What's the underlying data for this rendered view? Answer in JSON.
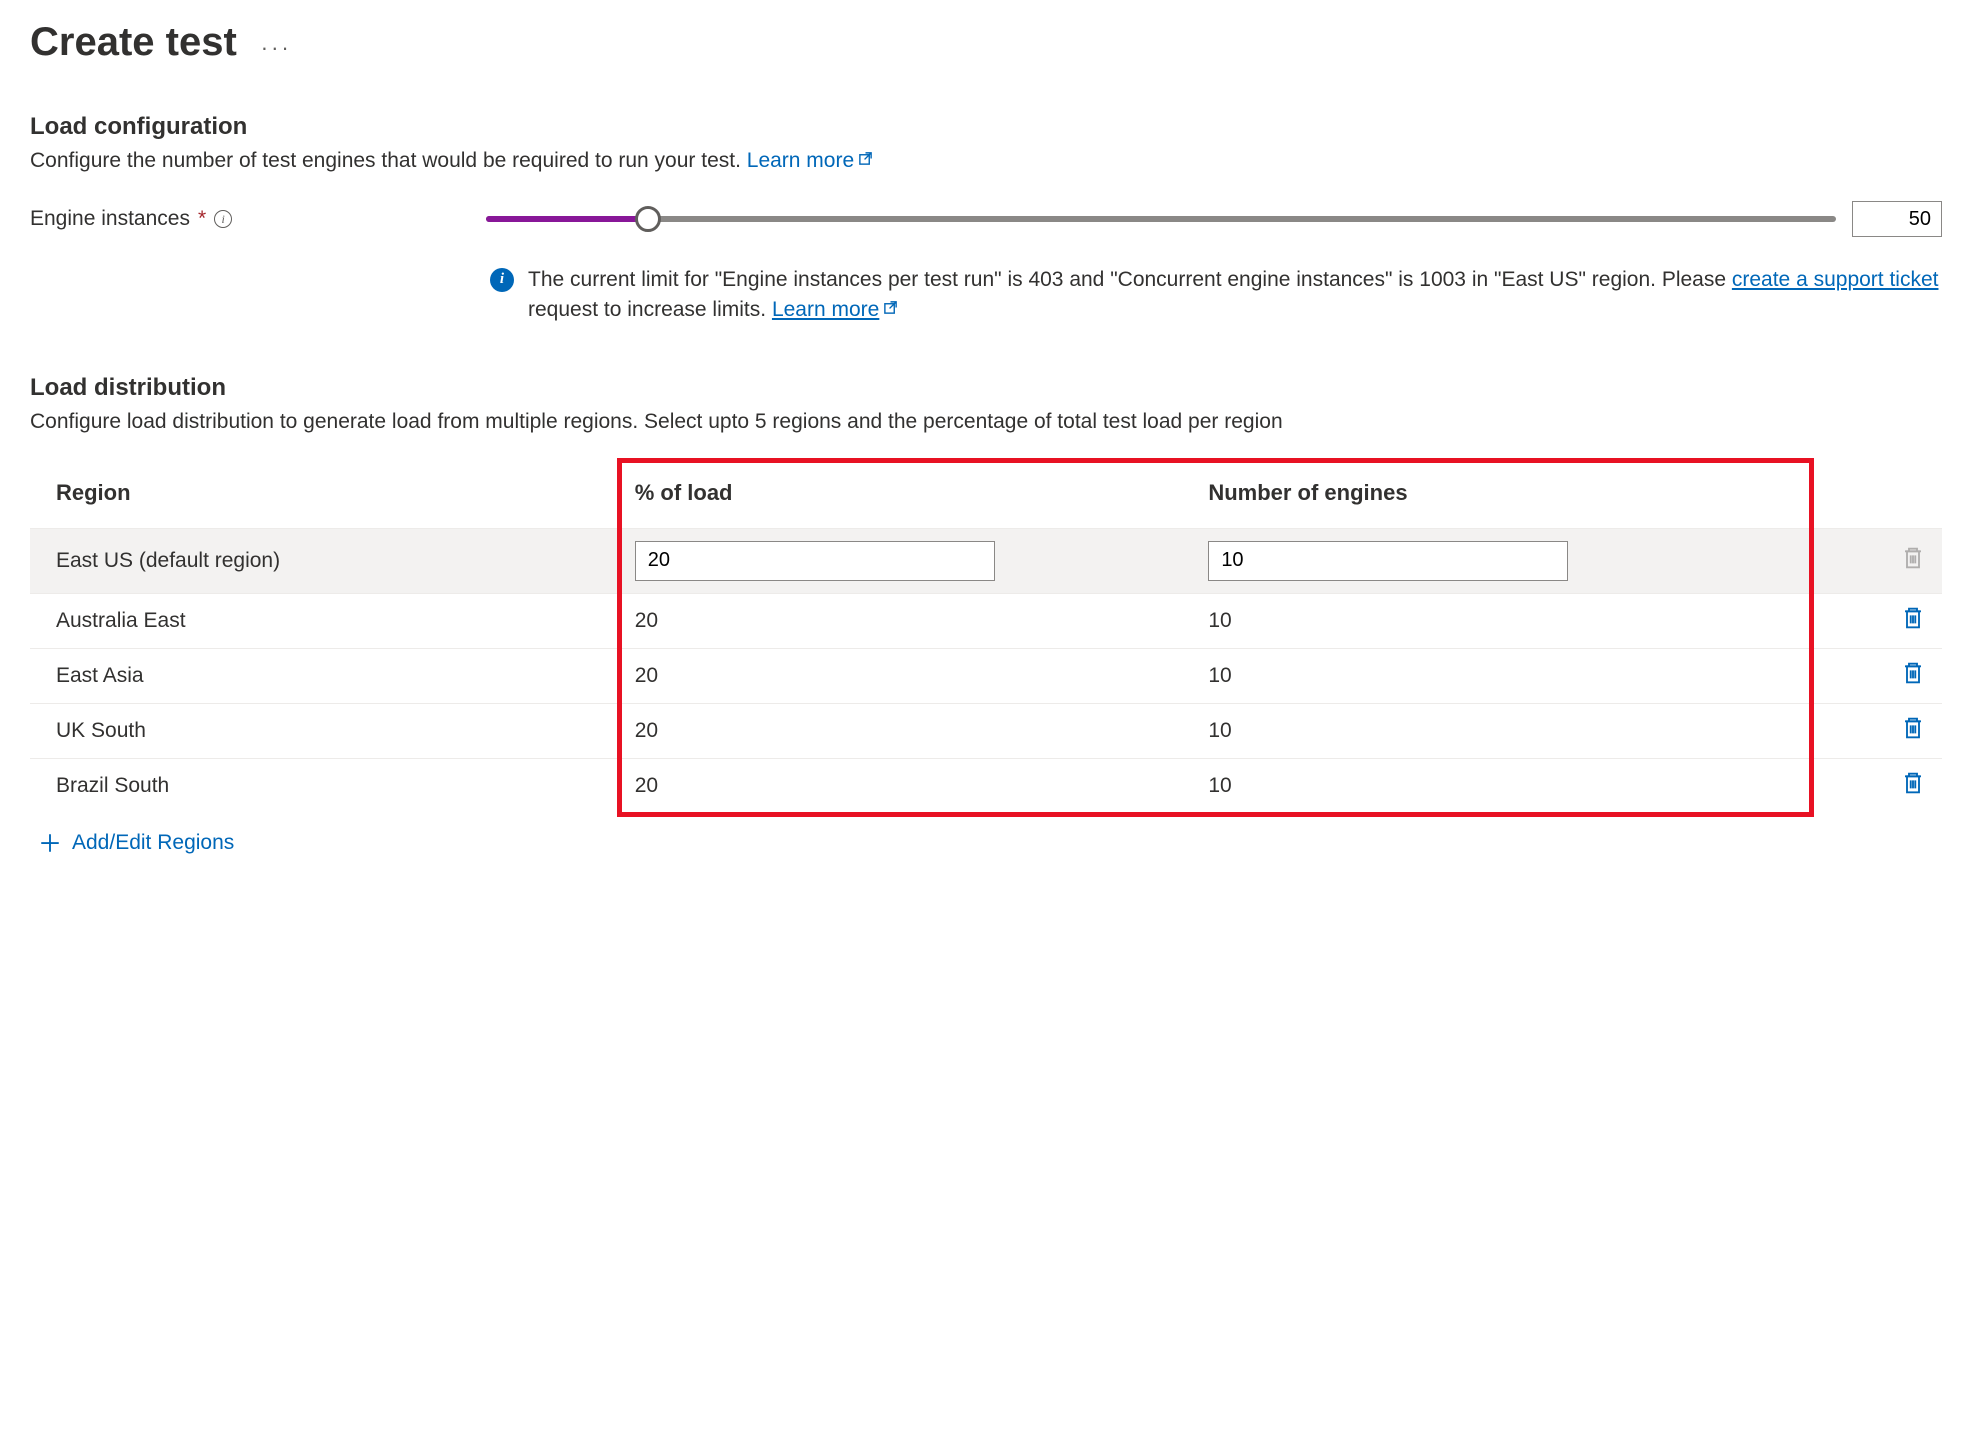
{
  "header": {
    "title": "Create test"
  },
  "load_config": {
    "heading": "Load configuration",
    "description": "Configure the number of test engines that would be required to run your test. ",
    "learn_more": "Learn more",
    "engine_label": "Engine instances",
    "engine_value": "50",
    "info_prefix": "The current limit for \"Engine instances per test run\" is 403 and \"Concurrent engine instances\" is 1003 in \"East US\" region. Please ",
    "info_link": "create a support ticket",
    "info_suffix": " request to increase limits. ",
    "info_learn_more": "Learn more"
  },
  "load_dist": {
    "heading": "Load distribution",
    "description": "Configure load distribution to generate load from multiple regions. Select upto 5 regions and the percentage of total test load per region",
    "columns": {
      "region": "Region",
      "load": "% of load",
      "engines": "Number of engines"
    },
    "rows": [
      {
        "region": "East US (default region)",
        "load": "20",
        "engines": "10",
        "removable": false,
        "editing": true
      },
      {
        "region": "Australia East",
        "load": "20",
        "engines": "10",
        "removable": true,
        "editing": false
      },
      {
        "region": "East Asia",
        "load": "20",
        "engines": "10",
        "removable": true,
        "editing": false
      },
      {
        "region": "UK South",
        "load": "20",
        "engines": "10",
        "removable": true,
        "editing": false
      },
      {
        "region": "Brazil South",
        "load": "20",
        "engines": "10",
        "removable": true,
        "editing": false
      }
    ],
    "add_link": "Add/Edit Regions"
  },
  "colors": {
    "accent": "#0067b8",
    "purple": "#881798",
    "highlight": "#e81123"
  }
}
